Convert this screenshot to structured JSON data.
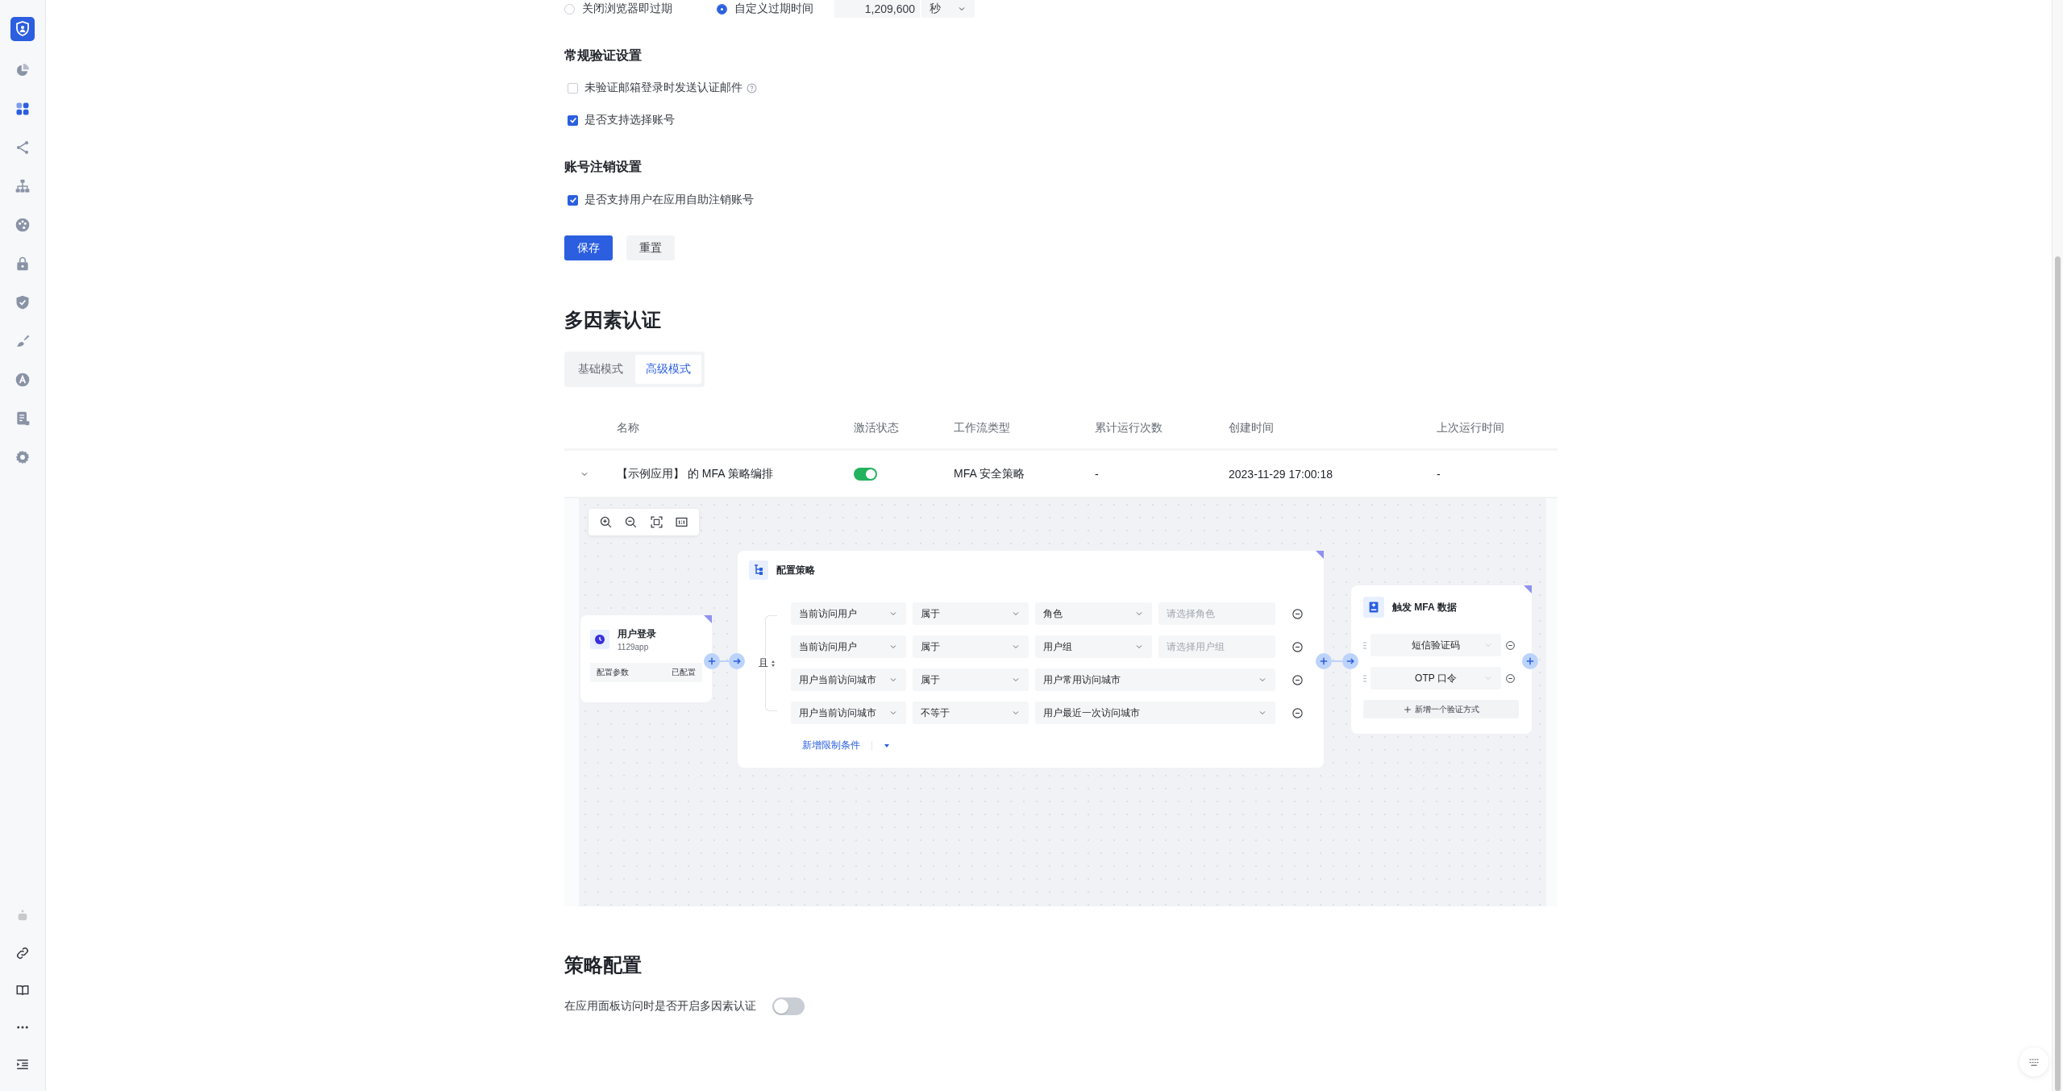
{
  "sidebar": {
    "items": [
      {
        "selected": false
      },
      {
        "selected": true
      },
      {
        "selected": false
      },
      {
        "selected": false
      },
      {
        "selected": false
      },
      {
        "selected": false
      },
      {
        "selected": false
      },
      {
        "selected": false
      },
      {
        "selected": false
      },
      {
        "selected": false
      },
      {
        "selected": false
      }
    ]
  },
  "expiry": {
    "options": [
      {
        "label": "关闭浏览器即过期",
        "selected": false
      },
      {
        "label": "自定义过期时间",
        "selected": true
      }
    ],
    "value": "1,209,600",
    "unit": "秒"
  },
  "general": {
    "title": "常规验证设置",
    "options": [
      {
        "label": "未验证邮箱登录时发送认证邮件",
        "checked": false,
        "help": true
      },
      {
        "label": "是否支持选择账号",
        "checked": true,
        "help": false
      }
    ]
  },
  "account": {
    "title": "账号注销设置",
    "options": [
      {
        "label": "是否支持用户在应用自助注销账号",
        "checked": true,
        "help": false
      }
    ]
  },
  "buttons": [
    {
      "label": "保存",
      "kind": "primary"
    },
    {
      "label": "重置",
      "kind": "secondary"
    }
  ],
  "mfa": {
    "title": "多因素认证",
    "tabs": [
      {
        "label": "基础模式",
        "selected": false
      },
      {
        "label": "高级模式",
        "selected": true
      }
    ],
    "table": {
      "columns": [
        "名称",
        "激活状态",
        "工作流类型",
        "累计运行次数",
        "创建时间",
        "上次运行时间"
      ],
      "rows": [
        {
          "expanded": true,
          "name": "【示例应用】 的 MFA 策略编排",
          "active": true,
          "type": "MFA 安全策略",
          "runs": "-",
          "created": "2023-11-29 17:00:18",
          "last_run": "-"
        }
      ]
    },
    "flow": {
      "trigger": {
        "title": "用户登录",
        "subtitle": "1129app",
        "param_label": "配置参数",
        "param_value": "已配置"
      },
      "policy": {
        "title": "配置策略",
        "logic": "且",
        "conditions": [
          {
            "subject": "当前访问用户",
            "operator": "属于",
            "object": "角色",
            "placeholder": "请选择角色"
          },
          {
            "subject": "当前访问用户",
            "operator": "属于",
            "object": "用户组",
            "placeholder": "请选择用户组"
          },
          {
            "subject": "用户当前访问城市",
            "operator": "属于",
            "object": "用户常用访问城市"
          },
          {
            "subject": "用户当前访问城市",
            "operator": "不等于",
            "object": "用户最近一次访问城市"
          }
        ],
        "add_label": "新增限制条件"
      },
      "mfa": {
        "title": "触发 MFA 数据",
        "methods": [
          "短信验证码",
          "OTP 口令"
        ],
        "add_label": "新增一个验证方式"
      }
    }
  },
  "strategy": {
    "title": "策略配置",
    "label": "在应用面板访问时是否开启多因素认证",
    "on": false
  }
}
